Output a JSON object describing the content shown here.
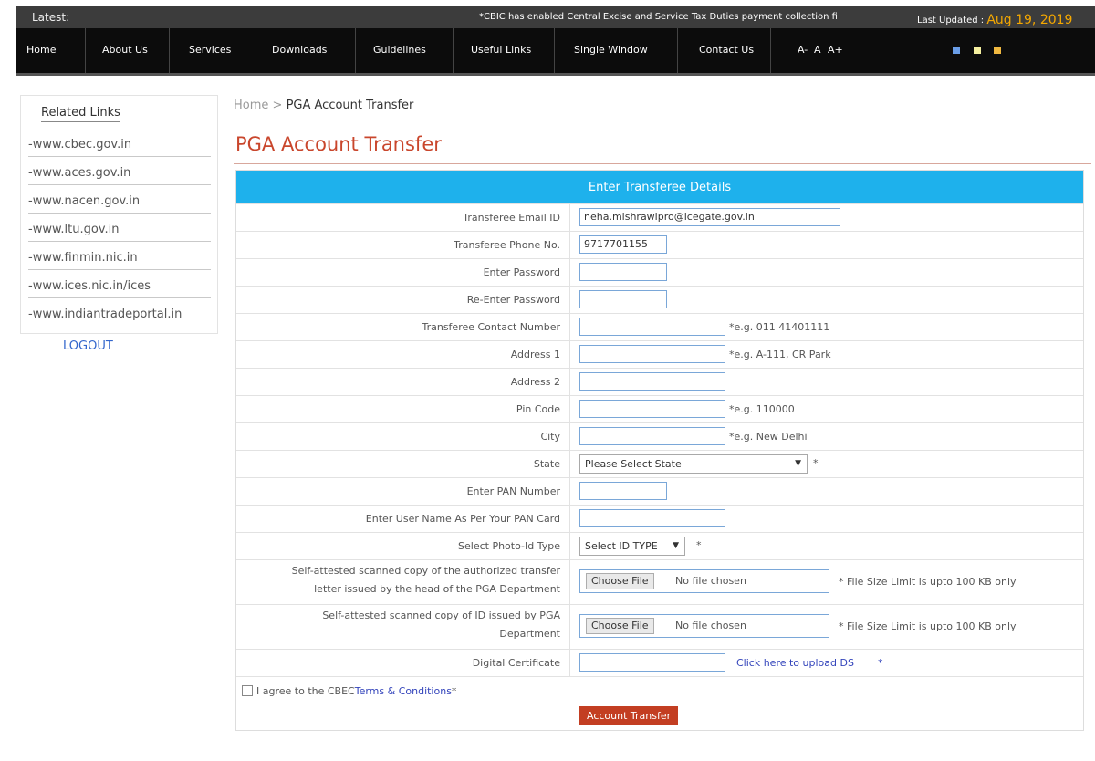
{
  "ticker": {
    "latest_label": "Latest:",
    "message": "*CBIC has enabled Central Excise and Service Tax Duties payment collection fi",
    "updated_label": "Last Updated :",
    "updated_date": "Aug 19, 2019"
  },
  "nav": {
    "items": [
      "Home",
      "About Us",
      "Services",
      "Downloads",
      "Guidelines",
      "Useful Links",
      "Single Window",
      "Contact Us"
    ],
    "font_sizes": [
      "A-",
      "A",
      "A+"
    ],
    "theme_colors": [
      "#6a9ee8",
      "#f5f0a0",
      "#f0b840"
    ]
  },
  "sidebar": {
    "title": "Related Links",
    "links": [
      "-www.cbec.gov.in",
      "-www.aces.gov.in",
      "-www.nacen.gov.in",
      "-www.ltu.gov.in",
      "-www.finmin.nic.in",
      "-www.ices.nic.in/ices",
      "-www.indiantradeportal.in"
    ],
    "logout": "LOGOUT"
  },
  "breadcrumb": {
    "home": "Home",
    "sep": " > ",
    "current": "PGA Account Transfer"
  },
  "page_title": "PGA Account Transfer",
  "form": {
    "header": "Enter Transferee Details",
    "email_label": "Transferee Email ID",
    "email_value": "neha.mishrawipro@icegate.gov.in",
    "phone_label": "Transferee Phone No.",
    "phone_value": "9717701155",
    "password_label": "Enter Password",
    "reenter_password_label": "Re-Enter Password",
    "contact_label": "Transferee Contact Number",
    "contact_hint": "*e.g. 011 41401111",
    "address1_label": "Address 1",
    "address1_hint": "*e.g. A-111, CR Park",
    "address2_label": "Address 2",
    "pincode_label": "Pin Code",
    "pincode_hint": "*e.g. 110000",
    "city_label": "City",
    "city_hint": "*e.g. New Delhi",
    "state_label": "State",
    "state_value": "Please Select State",
    "state_required": "*",
    "pan_label": "Enter PAN Number",
    "pan_name_label": "Enter User Name As Per Your PAN Card",
    "photo_id_label": "Select Photo-Id Type",
    "photo_id_value": "Select ID TYPE",
    "photo_id_required": "*",
    "transfer_letter_label_1": "Self-attested scanned copy of the authorized transfer",
    "transfer_letter_label_2": "letter issued by the head of the PGA Department",
    "id_copy_label_1": "Self-attested scanned copy of ID issued by PGA",
    "id_copy_label_2": "Department",
    "choose_file": "Choose File",
    "no_file": "No file chosen",
    "file_limit": "* File Size Limit is upto 100 KB only",
    "digital_cert_label": "Digital Certificate",
    "digital_cert_link": "Click here to upload DS",
    "digital_cert_required": "*",
    "agree_prefix": "I agree to the CBEC",
    "agree_link": "Terms & Conditions",
    "agree_suffix": "*",
    "submit": "Account Transfer"
  }
}
